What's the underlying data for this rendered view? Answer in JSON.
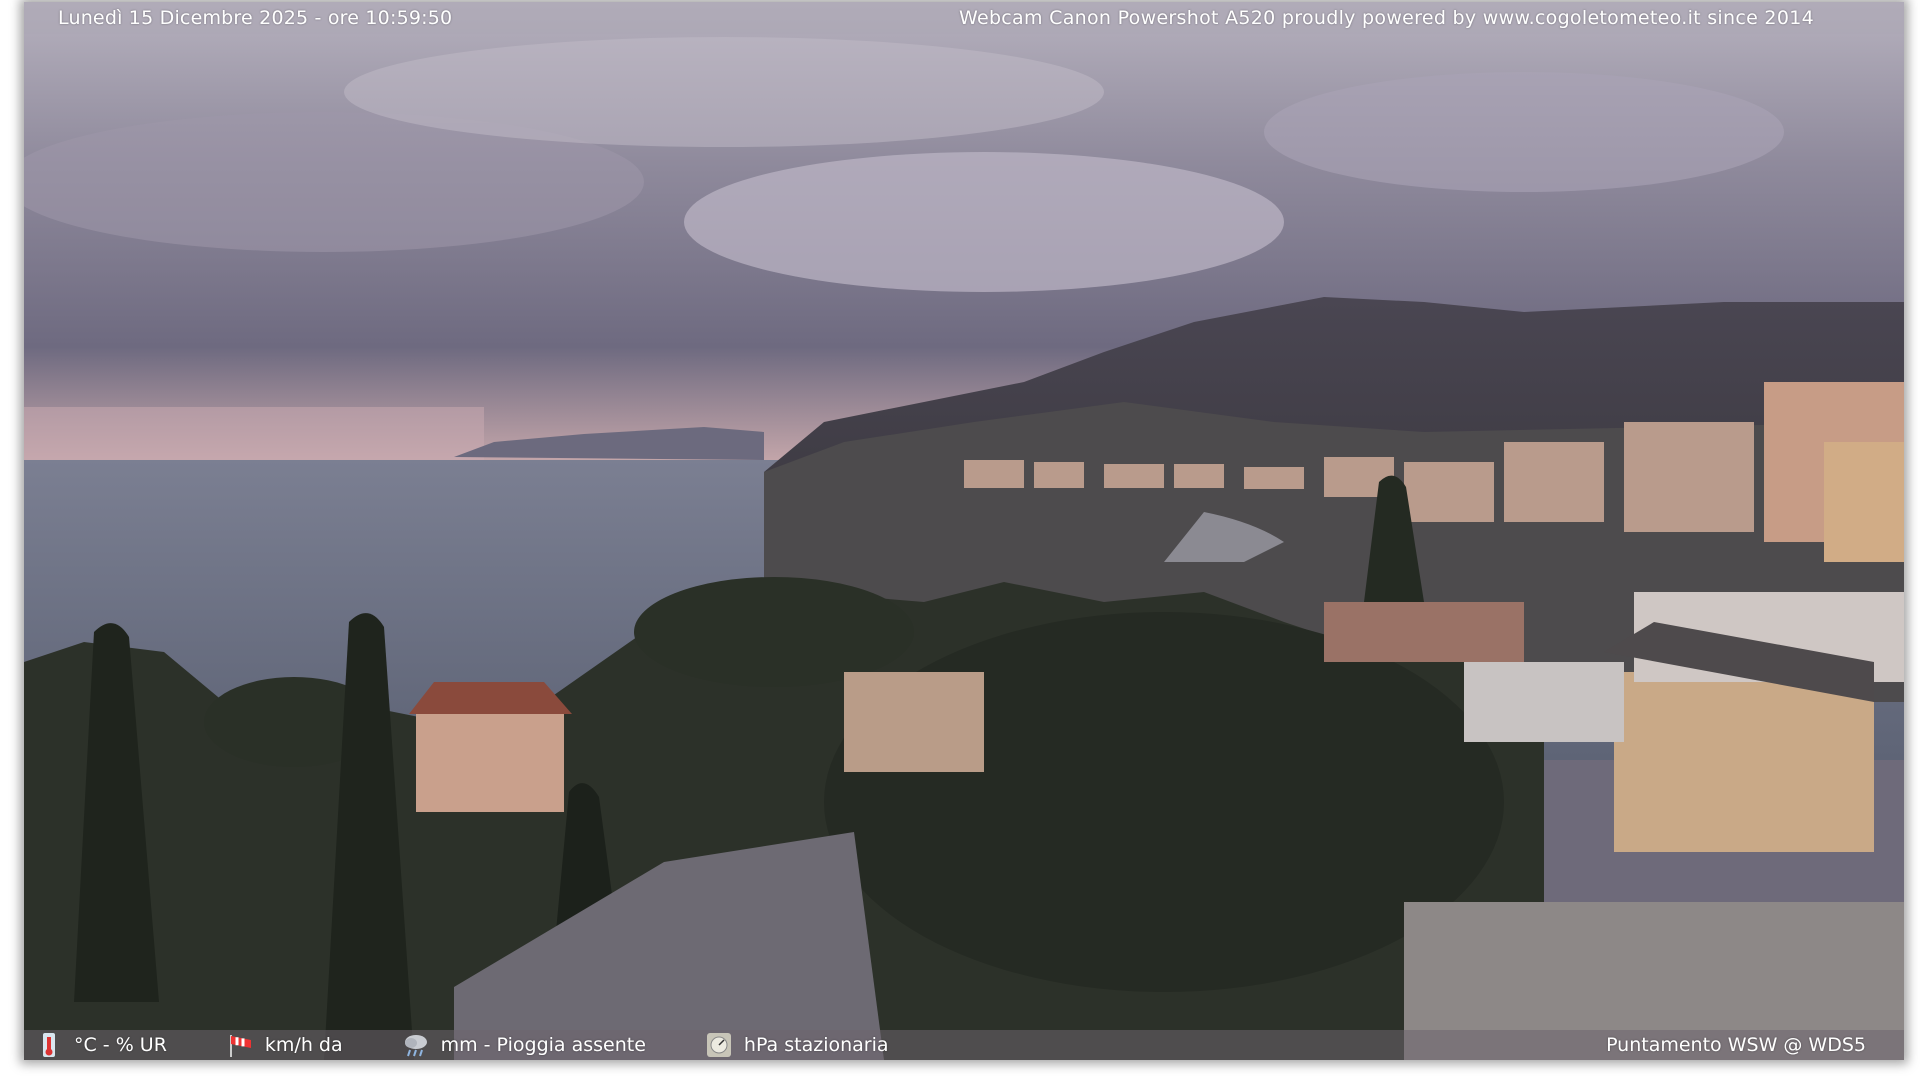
{
  "header": {
    "datetime": "Lunedì 15 Dicembre 2025 - ore 10:59:50",
    "credit": "Webcam Canon Powershot A520 proudly powered by www.cogoletometeo.it since 2014"
  },
  "footer": {
    "temperature": {
      "icon": "thermometer-icon",
      "text": "°C - % UR"
    },
    "wind": {
      "icon": "windsock-icon",
      "text": "km/h da"
    },
    "rain": {
      "icon": "rain-cloud-icon",
      "text": "mm - Pioggia assente"
    },
    "pressure": {
      "icon": "barometer-icon",
      "text": "hPa stazionaria"
    },
    "pointing": "Puntamento WSW  @ WDS5"
  },
  "colors": {
    "sky": "#7d7890",
    "sea": "#6d7385",
    "vegetation": "#2e332b",
    "buildings": "#c9a48c"
  }
}
